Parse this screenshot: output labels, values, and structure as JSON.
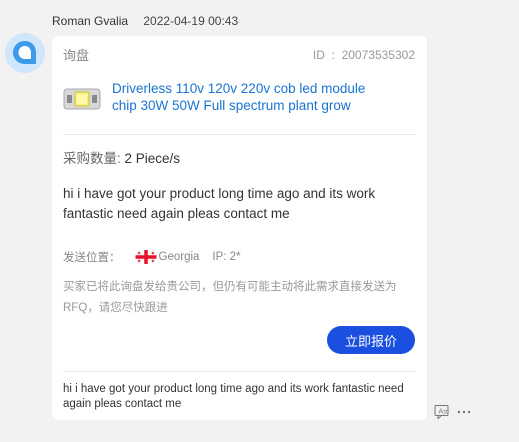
{
  "message_header": {
    "sender_name": "Roman Gvalia",
    "timestamp": "2022-04-19 00:43"
  },
  "card": {
    "title": "询盘",
    "id_text": "ID  :  20073535302",
    "product_title": "Driverless 110v 120v 220v cob led module chip 30W 50W Full spectrum plant grow",
    "quantity_label": "采购数量:",
    "quantity_value": "2 Piece/s",
    "message": "hi i have got your product long time ago and its work fantastic need again pleas contact me",
    "location_label": "发送位置：",
    "country": "Georgia",
    "ip_text": "IP: 2*",
    "notice": "买家已将此询盘发给贵公司，但仍有可能主动将此需求直接发送为RFQ，请您尽快跟进",
    "quote_button": "立即报价",
    "footer_message": "hi i have got your product long time ago and its work fantastic need again pleas contact me"
  },
  "icons": {
    "avatar": "chat-bubble-icon",
    "flag": "georgia-flag-icon",
    "translate": "translate-icon",
    "more": "more-icon"
  },
  "colors": {
    "link": "#1a74d2",
    "button": "#1b4fe0",
    "avatar_bg": "#cfe6fb",
    "avatar_icon": "#3d9be9"
  }
}
